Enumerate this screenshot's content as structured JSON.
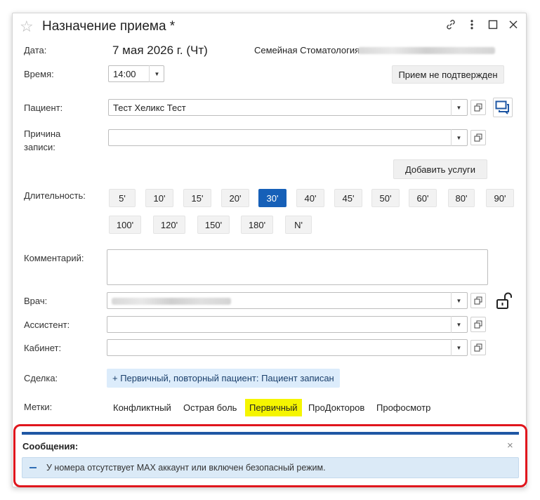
{
  "header": {
    "title": "Назначение приема *",
    "icons": [
      "star-icon",
      "link-icon",
      "more-icon",
      "maximize-icon",
      "close-icon"
    ]
  },
  "form": {
    "date_label": "Дата:",
    "date_value": "7 мая 2026 г. (Чт)",
    "clinic_value": "Семейная Стоматология",
    "time_label": "Время:",
    "time_value": "14:00",
    "status_button": "Прием не подтвержден",
    "patient_label": "Пациент:",
    "patient_value": "Тест Хеликс Тест",
    "reason_label_1": "Причина",
    "reason_label_2": "записи:",
    "reason_value": "",
    "add_services_button": "Добавить услуги",
    "duration_label": "Длительность:",
    "durations_row1": [
      "5'",
      "10'",
      "15'",
      "20'",
      "30'",
      "40'",
      "45'",
      "50'",
      "60'",
      "80'",
      "90'"
    ],
    "durations_row2": [
      "100'",
      "120'",
      "150'",
      "180'",
      "N'"
    ],
    "duration_selected": "30'",
    "comment_label": "Комментарий:",
    "comment_value": "",
    "doctor_label": "Врач:",
    "assistant_label": "Ассистент:",
    "assistant_value": "",
    "cabinet_label": "Кабинет:",
    "cabinet_value": "",
    "deal_label": "Сделка:",
    "deal_value": "+ Первичный, повторный пациент: Пациент записан",
    "tags_label": "Метки:",
    "tags": [
      "Конфликтный",
      "Острая боль",
      "Первичный",
      "ПроДокторов",
      "Профосмотр"
    ],
    "tag_highlighted": "Первичный"
  },
  "messages": {
    "title": "Сообщения:",
    "close": "×",
    "text": "У номера отсутствует MAX аккаунт или включен безопасный режим."
  },
  "colors": {
    "accent": "#1660b8",
    "highlight": "#f5f500",
    "frame": "#e0161d",
    "message_bg": "#dbeaf7"
  }
}
